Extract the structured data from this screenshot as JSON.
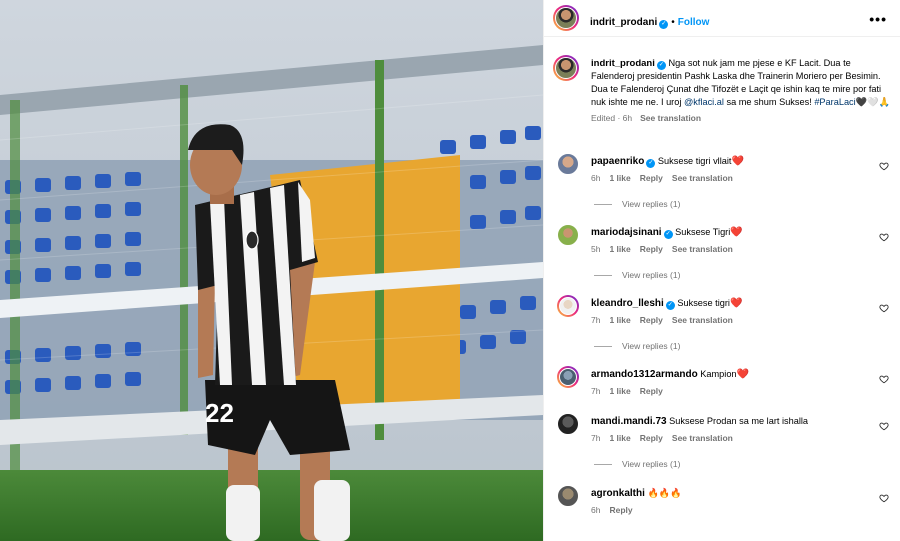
{
  "post": {
    "username": "indrit_prodani",
    "follow_label": "Follow",
    "more_label": "•••",
    "caption_text": "Nga sot nuk jam me pjese e KF Lacit. Dua te Falenderoj presidentin Pashk Laska dhe Trainerin Moriero per Besimin. Dua te Falenderoj Çunat dhe Tifozët e Laçit qe ishin kaq te mire por fati nuk ishte me ne. I uroj",
    "caption_mention": "@kflaci.al",
    "caption_after": " sa me shum Sukses!",
    "caption_hashtag": "#ParaLaci",
    "caption_emojis": "🖤🤍🙏",
    "edited_time": "Edited · 6h",
    "see_translation": "See translation",
    "photo_shirt_number": "22"
  },
  "comments": [
    {
      "username": "papaenriko",
      "verified": true,
      "text": "Suksese tigri vllait",
      "emoji": "❤️",
      "time": "6h",
      "likes": "1 like",
      "reply": "Reply",
      "translate": "See translation",
      "view_replies": "View replies (1)"
    },
    {
      "username": "mariodajsinani",
      "verified": true,
      "text": "Suksese Tigri",
      "emoji": "❤️",
      "time": "5h",
      "likes": "1 like",
      "reply": "Reply",
      "translate": "See translation",
      "view_replies": "View replies (1)"
    },
    {
      "username": "kleandro_lleshi",
      "verified": true,
      "text": "Suksese tigri",
      "emoji": "❤️",
      "time": "7h",
      "likes": "1 like",
      "reply": "Reply",
      "translate": "See translation",
      "view_replies": "View replies (1)"
    },
    {
      "username": "armando1312armando",
      "verified": false,
      "text": "Kampion",
      "emoji": "❤️",
      "time": "7h",
      "likes": "1 like",
      "reply": "Reply",
      "translate": "",
      "view_replies": ""
    },
    {
      "username": "mandi.mandi.73",
      "verified": false,
      "text": "Suksese Prodan sa me lart ishalla",
      "emoji": "",
      "time": "7h",
      "likes": "1 like",
      "reply": "Reply",
      "translate": "See translation",
      "view_replies": "View replies (1)"
    },
    {
      "username": "agronkalthi",
      "verified": false,
      "text": "🔥🔥🔥",
      "emoji": "",
      "time": "6h",
      "likes": "",
      "reply": "Reply",
      "translate": "",
      "view_replies": ""
    }
  ],
  "colors": {
    "accent": "#0095f6",
    "muted": "#737373",
    "heart": "#e0245e"
  },
  "icons": {
    "verified": "verified-badge-icon",
    "like": "heart-outline-icon",
    "more": "more-options-icon"
  }
}
